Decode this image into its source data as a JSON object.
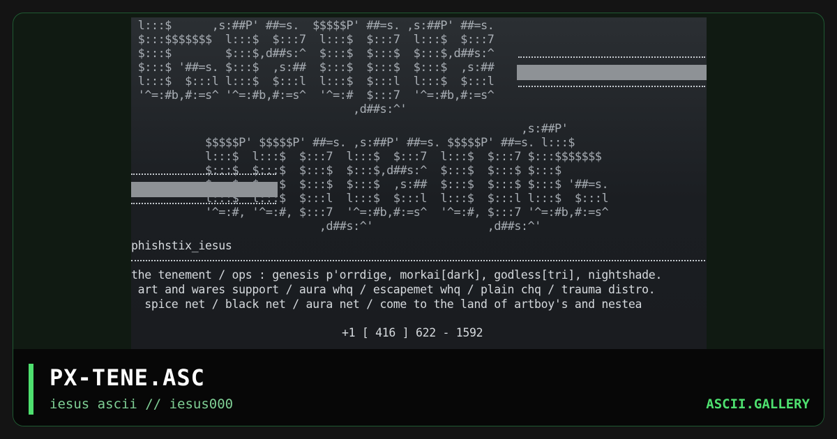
{
  "artwork": {
    "logo_lines": [
      " l:::$      ,s:##P' ##=s.  $$$$$P' ##=s. ,s:##P' ##=s.",
      " $:::$$$$$$$  l:::$  $:::7  l:::$  $:::7  l:::$  $:::7",
      " $:::$        $:::$,d##s:^  $:::$  $:::$  $:::$,d##s:^",
      " $:::$ '##=s. $:::$  ,s:##  $:::$  $:::$  $:::$  ,s:##",
      " l:::$  $:::l l:::$  $:::l  l:::$  $:::l  l:::$  $:::l",
      " '^=:#b,#:=s^ '^=:#b,#:=s^  '^=:#  $:::7  '^=:#b,#:=s^",
      "                                 ,d##s:^'",
      "",
      "                                                          ,s:##P'",
      "           $$$$$P' $$$$$P' ##=s. ,s:##P' ##=s. $$$$$P' ##=s. l:::$",
      "           l:::$  l:::$  $:::7  l:::$  $:::7  l:::$  $:::7 $:::$$$$$$$",
      "           $:::$  $:::$  $:::$  $:::$,d##s:^  $:::$  $:::$ $:::$",
      "           $:::$  $:::$  $:::$  $:::$  ,s:##  $:::$  $:::$ $:::$ '##=s.",
      "           l:::$  l:::$  $:::l  l:::$  $:::l  l:::$  $:::l l:::$  $:::l",
      "           '^=:#, '^=:#, $:::7  '^=:#b,#:=s^  '^=:#, $:::7 '^=:#b,#:=s^",
      "                            ,d##s:^'                 ,d##s:^'"
    ],
    "handle": "phishstix_iesus",
    "credits": [
      "the tenement / ops : genesis p'orrdige, morkai[dark], godless[tri], nightshade.",
      " art and wares support / aura whq / escapemet whq / plain chq / trauma distro.",
      "  spice net / black net / aura net / come to the land of artboy's and nestea"
    ],
    "phone": "+1 [ 416 ] 622 - 1592"
  },
  "footer": {
    "title": "PX-TENE.ASC",
    "subtitle": "iesus ascii // iesus000",
    "brand": "ASCII.GALLERY"
  },
  "colors": {
    "accent": "#4ee06f",
    "card_bg": "#101a12",
    "footer_bg": "#070707",
    "art_bg": "#1d2024"
  }
}
